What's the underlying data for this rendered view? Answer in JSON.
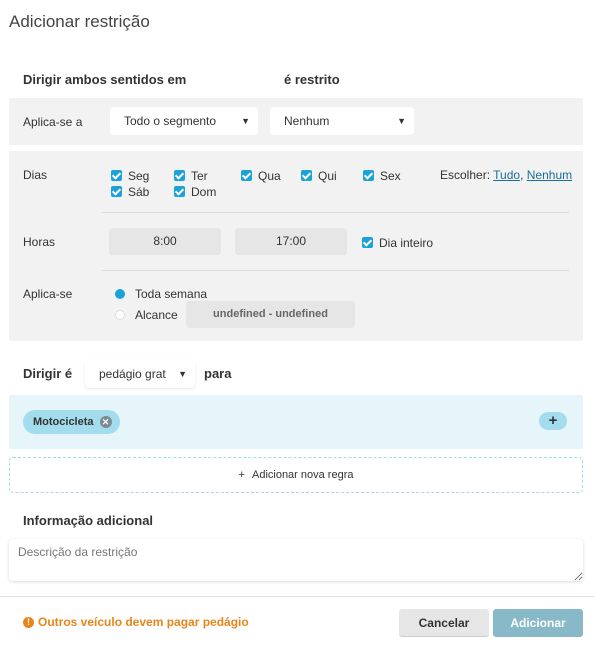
{
  "dialog": {
    "title": "Adicionar restrição"
  },
  "direction": {
    "left": "Dirigir ambos sentidos em",
    "right": "é restrito"
  },
  "applies_to": {
    "label": "Aplica-se a",
    "segment_select": "Todo o segmento",
    "lane_select": "Nenhum"
  },
  "days": {
    "label": "Dias",
    "items": [
      "Seg",
      "Ter",
      "Qua",
      "Qui",
      "Sex",
      "Sáb",
      "Dom"
    ],
    "choose_label": "Escolher:",
    "choose_all": "Tudo",
    "choose_sep": ",",
    "choose_none": "Nenhum"
  },
  "hours": {
    "label": "Horas",
    "from": "8:00",
    "to": "17:00",
    "all_day": "Dia inteiro"
  },
  "period": {
    "label": "Aplica-se",
    "whole_week": "Toda semana",
    "range": "Alcance",
    "range_value": "undefined - undefined"
  },
  "drive": {
    "prefix": "Dirigir é",
    "select": "pedágio grat",
    "suffix": "para"
  },
  "vehicles": {
    "chips": [
      "Motocicleta"
    ],
    "add": "+"
  },
  "add_rule": {
    "icon": "+",
    "label": "Adicionar nova regra"
  },
  "additional": {
    "heading": "Informação adicional",
    "placeholder": "Descrição da restrição"
  },
  "footer": {
    "warning_icon": "!",
    "warning": "Outros veículo devem pagar pedágio",
    "cancel": "Cancelar",
    "submit": "Adicionar"
  },
  "colors": {
    "accent": "#1aa3d8",
    "chip_bg": "#a3dced",
    "warning": "#e8851a",
    "primary_button": "#88b9c9"
  }
}
